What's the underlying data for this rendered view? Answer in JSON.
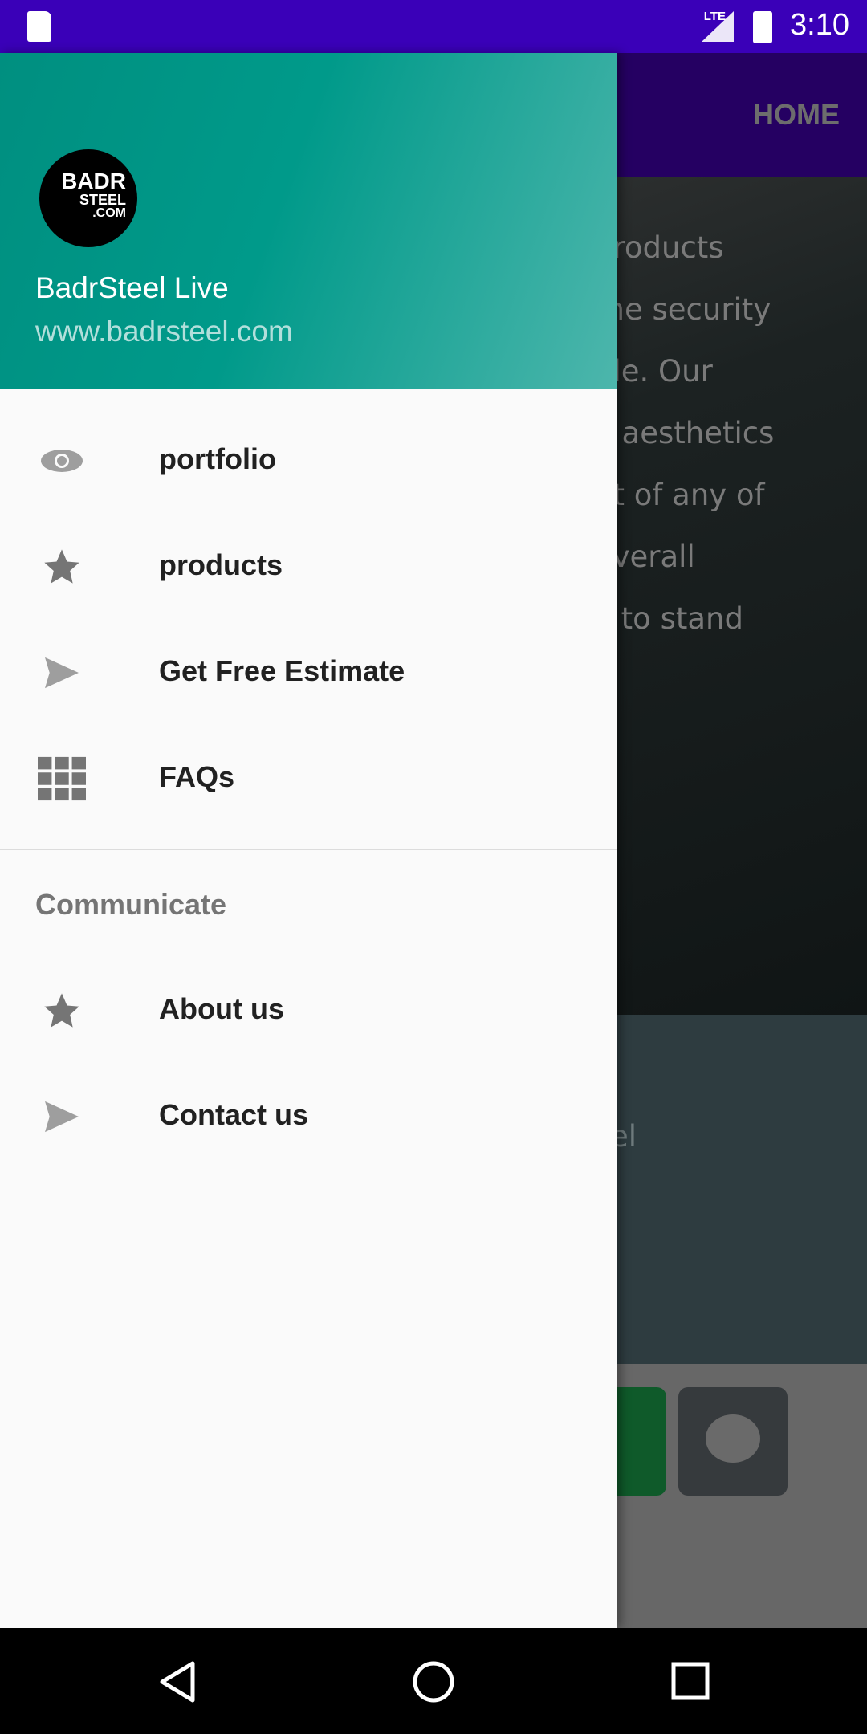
{
  "status_bar": {
    "time": "3:10",
    "network": "LTE",
    "icons": [
      "sd-card-icon",
      "signal-icon",
      "battery-charging-icon"
    ]
  },
  "toolbar": {
    "title": "HOME"
  },
  "background": {
    "hero_lines": "products\nthe security\nple. Our\ne aesthetics\nnt of any of\noverall\ny to stand",
    "band_text": "el"
  },
  "drawer": {
    "logo": {
      "line1": "BADR",
      "line2": "STEEL",
      "line3": ".COM"
    },
    "name": "BadrSteel Live",
    "website": "www.badrsteel.com",
    "items": [
      {
        "label": "portfolio",
        "icon": "eye-icon"
      },
      {
        "label": "products",
        "icon": "star-icon"
      },
      {
        "label": "Get Free Estimate",
        "icon": "send-icon"
      },
      {
        "label": "FAQs",
        "icon": "grid-icon"
      }
    ],
    "section_title": "Communicate",
    "section_items": [
      {
        "label": "About us",
        "icon": "star-icon"
      },
      {
        "label": "Contact us",
        "icon": "send-icon"
      }
    ]
  },
  "colors": {
    "status_bar": "#3a00b8",
    "toolbar": "#250062",
    "header": "#009688",
    "whatsapp": "#0f5a2a"
  }
}
